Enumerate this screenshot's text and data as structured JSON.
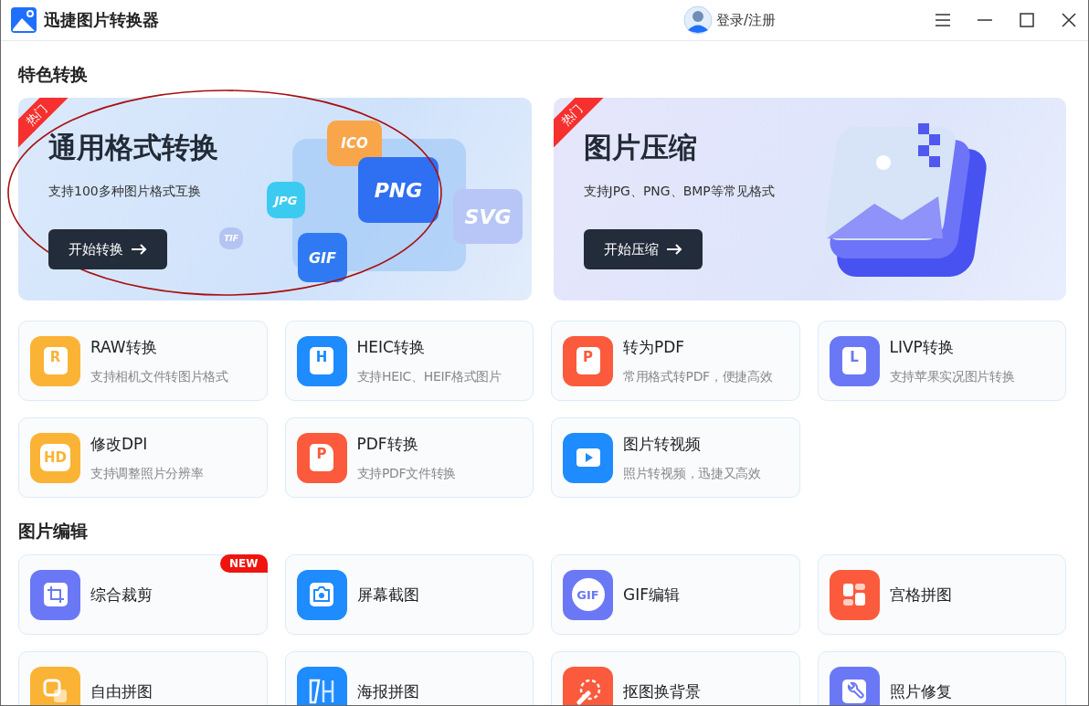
{
  "window": {
    "title": "迅捷图片转换器",
    "user_label": "登录/注册"
  },
  "sections": [
    {
      "title": "特色转换",
      "banners": [
        {
          "badge": "热门",
          "title": "通用格式转换",
          "subtitle": "支持100多种图片格式互换",
          "button": "开始转换",
          "circled": true,
          "kind": "formats",
          "format_tiles": [
            "ICO",
            "JPG",
            "PNG",
            "SVG",
            "TIF",
            "GIF"
          ]
        },
        {
          "badge": "热门",
          "title": "图片压缩",
          "subtitle": "支持JPG、PNG、BMP等常见格式",
          "button": "开始压缩",
          "circled": false,
          "kind": "stack"
        }
      ],
      "tools": [
        {
          "title": "RAW转换",
          "subtitle": "支持相机文件转图片格式",
          "color": "#fbb335",
          "icon": {
            "kind": "letter",
            "text": "R"
          }
        },
        {
          "title": "HEIC转换",
          "subtitle": "支持HEIC、HEIF格式图片",
          "color": "#1e8bff",
          "icon": {
            "kind": "letter",
            "text": "H"
          }
        },
        {
          "title": "转为PDF",
          "subtitle": "常用格式转PDF，便捷高效",
          "color": "#fb5a3c",
          "icon": {
            "kind": "letter",
            "text": "P"
          }
        },
        {
          "title": "LIVP转换",
          "subtitle": "支持苹果实况图片转换",
          "color": "#6b78f5",
          "icon": {
            "kind": "letter",
            "text": "L"
          }
        },
        {
          "title": "修改DPI",
          "subtitle": "支持调整照片分辨率",
          "color": "#fbb335",
          "icon": {
            "kind": "badge",
            "text": "HD"
          }
        },
        {
          "title": "PDF转换",
          "subtitle": "支持PDF文件转换",
          "color": "#fb5a3c",
          "icon": {
            "kind": "scan",
            "text": "P"
          }
        },
        {
          "title": "图片转视频",
          "subtitle": "照片转视频，迅捷又高效",
          "color": "#1e8bff",
          "icon": {
            "kind": "play"
          }
        }
      ]
    },
    {
      "title": "图片编辑",
      "tools": [
        {
          "title": "综合裁剪",
          "badge": "NEW",
          "color": "#6b78f5",
          "icon": {
            "kind": "crop"
          }
        },
        {
          "title": "屏幕截图",
          "color": "#1e8bff",
          "icon": {
            "kind": "camera"
          }
        },
        {
          "title": "GIF编辑",
          "color": "#6b78f5",
          "icon": {
            "kind": "circle",
            "text": "GIF"
          }
        },
        {
          "title": "宫格拼图",
          "color": "#fb5a3c",
          "icon": {
            "kind": "grid"
          }
        },
        {
          "title": "自由拼图",
          "color": "#fbb335",
          "icon": {
            "kind": "square"
          }
        },
        {
          "title": "海报拼图",
          "color": "#1e8bff",
          "icon": {
            "kind": "poster"
          }
        },
        {
          "title": "抠图换背景",
          "color": "#fb5a3c",
          "icon": {
            "kind": "cutout"
          }
        },
        {
          "title": "照片修复",
          "color": "#6b78f5",
          "icon": {
            "kind": "wrench"
          }
        }
      ]
    }
  ]
}
